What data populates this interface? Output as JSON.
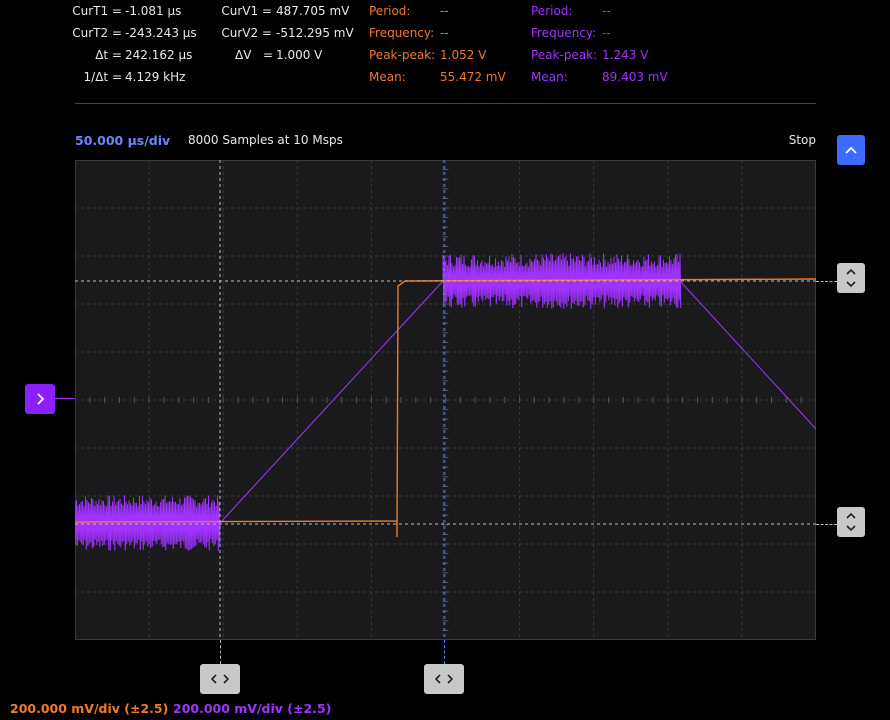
{
  "cursors": {
    "t1": {
      "label": "CurT1 =",
      "value": "-1.081 µs"
    },
    "t2": {
      "label": "CurT2 =",
      "value": "-243.243 µs"
    },
    "dt": {
      "label": "Δt =",
      "value": "242.162 µs"
    },
    "inv_dt": {
      "label": "1/Δt =",
      "value": "4.129 kHz"
    },
    "v1": {
      "label": "CurV1 =",
      "value": "487.705 mV"
    },
    "v2": {
      "label": "CurV2 =",
      "value": "-512.295 mV"
    },
    "dv": {
      "label": "ΔV",
      "eq": "=",
      "value": "1.000 V"
    }
  },
  "channel1_meas": {
    "period_label": "Period:",
    "period_value": "--",
    "frequency_label": "Frequency:",
    "frequency_value": "--",
    "pkpk_label": "Peak-peak:",
    "pkpk_value": "1.052 V",
    "mean_label": "Mean:",
    "mean_value": "55.472 mV"
  },
  "channel2_meas": {
    "period_label": "Period:",
    "period_value": "--",
    "frequency_label": "Frequency:",
    "frequency_value": "--",
    "pkpk_label": "Peak-peak:",
    "pkpk_value": "1.243 V",
    "mean_label": "Mean:",
    "mean_value": "89.403 mV"
  },
  "timebase": "50.000 µs/div",
  "samples": "8000 Samples at 10 Msps",
  "run_state": "Stop",
  "ch1_scale": "200.000 mV/div (±2.5)",
  "ch2_scale": "200.000 mV/div (±2.5)",
  "colors": {
    "ch1": "#f07a28",
    "ch2": "#a033ff",
    "cursor_time": "#6a86ff",
    "grid_bg": "#1a1a1c",
    "accent_button": "#3b6cff",
    "trigger_marker": "#8a1fff"
  },
  "icons": {
    "collapse": "chevron-up-icon",
    "cursor_vertical": "chevron-up-down-icon",
    "cursor_horizontal": "chevron-left-right-icon",
    "trigger": "chevron-right-icon"
  }
}
